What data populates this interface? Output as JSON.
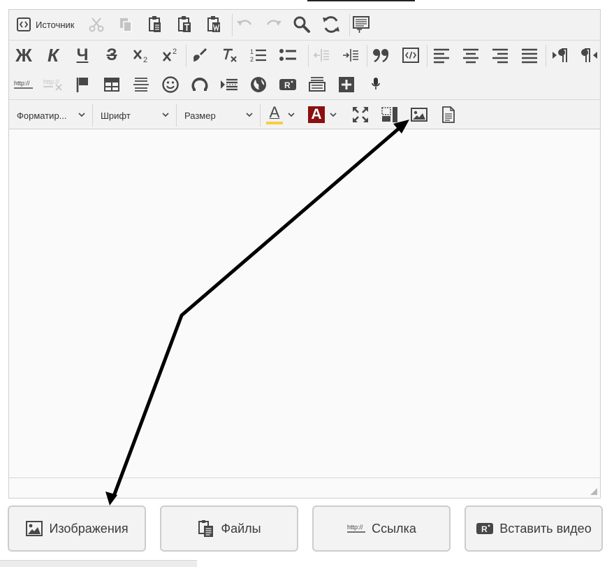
{
  "toolbar": {
    "source_label": "Источник",
    "bold_glyph": "Ж",
    "italic_glyph": "К",
    "underline_glyph": "Ч",
    "strike_glyph": "З",
    "link_glyph": "http://",
    "video_glyph": "R",
    "format_placeholder": "Форматир...",
    "font_placeholder": "Шрифт",
    "size_placeholder": "Размер",
    "text_color_glyph": "A",
    "bg_color_glyph": "A"
  },
  "colors": {
    "text_color_bar": "#f4d03f",
    "bg_color_box": "#8b1010",
    "arrow": "#000000"
  },
  "actions": {
    "images_label": "Изображения",
    "files_label": "Файлы",
    "link_label": "Ссылка",
    "link_icon_text": "http://",
    "video_label": "Вставить видео",
    "video_icon_text": "R"
  }
}
